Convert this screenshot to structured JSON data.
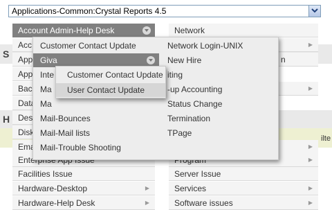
{
  "select": {
    "value": "Applications-Common:Crystal Reports 4.5"
  },
  "bg_letters": [
    "S",
    "H"
  ],
  "bg_right_text": "ilte",
  "left_menu": {
    "active": "Account Admin-Help Desk",
    "items": [
      "Acc",
      "App",
      "App",
      "Bac",
      "Data",
      "Des",
      "Disk",
      "Ema",
      "Enterprise App Issue",
      "Facilities Issue",
      "Hardware-Desktop",
      "Hardware-Help Desk"
    ]
  },
  "right_menu": {
    "items": [
      "Network",
      "Network Login-UNIX",
      "New Hire",
      "iting",
      "-up Accounting",
      "Status Change",
      "Termination",
      "TPage",
      "",
      "Program",
      "Server Issue",
      "Services",
      "Software issues"
    ],
    "partial_right": "n"
  },
  "submenu1": {
    "items": [
      "Customer Contact Update",
      "Giva",
      "Inte",
      "Ma",
      "Ma",
      "Mail-Bounces",
      "Mail-Mail lists",
      "Mail-Trouble Shooting"
    ],
    "right_col": [
      "Network Login-UNIX",
      "New Hire",
      "iting",
      "-up Accounting",
      "Status Change",
      "Termination",
      "TPage"
    ]
  },
  "submenu2": {
    "items": [
      "Customer Contact Update",
      "User Contact Update"
    ]
  }
}
